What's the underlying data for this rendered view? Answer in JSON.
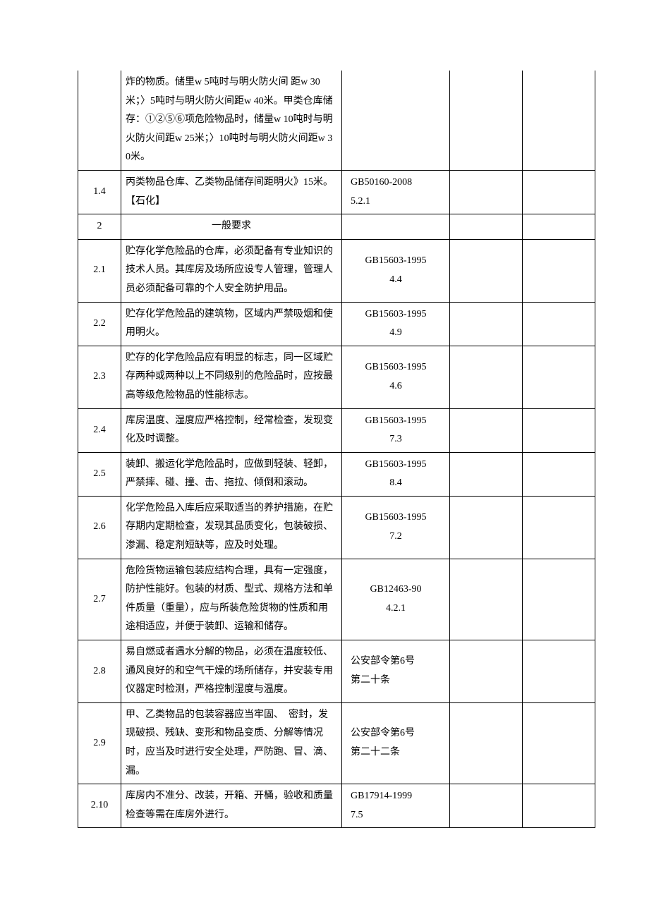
{
  "rows": [
    {
      "num": "",
      "content": "炸的物质。储里w 5吨时与明火防火间 距w 30米；〉5吨时与明火防火间距w 40米。甲类仓库储存：①②⑤⑥项危险物品时，储量w 10吨时与明火防火间距w 25米；〉10吨时与明火防火间距w 30米。",
      "ref": "",
      "noTop": true
    },
    {
      "num": "1.4",
      "content": "丙类物品仓库、乙类物品储存间距明火》15米。【石化】",
      "ref": "GB50160-2008\n5.2.1",
      "refAlign": "left"
    },
    {
      "num": "2",
      "content": "一般要求",
      "ref": "",
      "contentCenter": true
    },
    {
      "num": "2.1",
      "content": "贮存化学危险品的仓库，必须配备有专业知识的技术人员。其库房及场所应设专人管理，管理人员必须配备可靠的个人安全防护用品。",
      "ref": "GB15603-1995\n4.4"
    },
    {
      "num": "2.2",
      "content": "贮存化学危险品的建筑物，区域内严禁吸烟和使用明火。",
      "ref": "GB15603-1995\n4.9"
    },
    {
      "num": "2.3",
      "content": "贮存的化学危险品应有明显的标志，同一区域贮存两种或两种以上不同级别的危险品时，应按最高等级危险物品的性能标志。",
      "ref": "GB15603-1995\n4.6"
    },
    {
      "num": "2.4",
      "content": "库房温度、湿度应严格控制，经常检查，发现变化及时调整。",
      "ref": "GB15603-1995\n7.3"
    },
    {
      "num": "2.5",
      "content": "装卸、搬运化学危险品时，应做到轻装、轻卸，严禁摔、碰、撞、击、拖拉、倾倒和滚动。",
      "ref": "GB15603-1995\n8.4"
    },
    {
      "num": "2.6",
      "content": "化学危险品入库后应采取适当的养护措施，在贮存期内定期检查，发现其品质变化，包装破损、渗漏、稳定剂短缺等，应及时处理。",
      "ref": "GB15603-1995\n7.2"
    },
    {
      "num": "2.7",
      "content": "危险货物运输包装应结构合理，具有一定强度，防护性能好。包装的材质、型式、规格方法和单件质量（重量），应与所装危险货物的性质和用途相适应，并便于装卸、运输和储存。",
      "ref": "GB12463-90\n4.2.1"
    },
    {
      "num": "2.8",
      "content": "易自燃或者遇水分解的物品，必须在温度较低、通风良好的和空气干燥的场所储存，并安装专用仪器定时检测，严格控制湿度与温度。",
      "ref": "公安部令第6号\n第二十条",
      "refAlign": "left"
    },
    {
      "num": "2.9",
      "content": "甲、乙类物品的包装容器应当牢固、　密封，发现破损、残缺、变形和物品变质、分解等情况时，应当及时进行安全处理，严防跑、冒、滴、漏。",
      "ref": "公安部令第6号\n第二十二条",
      "refAlign": "left"
    },
    {
      "num": "2.10",
      "content": "库房内不准分、改装，开箱、开桶，验收和质量检查等需在库房外进行。",
      "ref": "GB17914-1999\n7.5",
      "refAlign": "left"
    }
  ]
}
